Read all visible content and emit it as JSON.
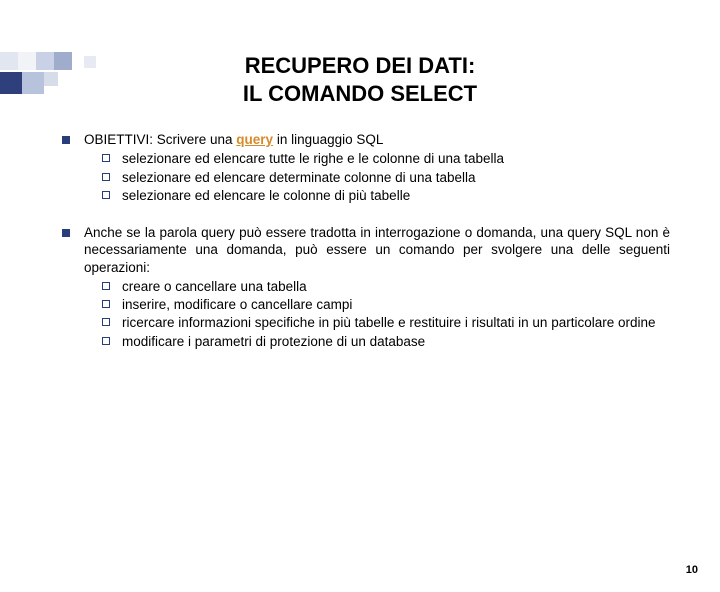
{
  "title": {
    "line1": "RECUPERO DEI DATI:",
    "line2": "IL COMANDO SELECT"
  },
  "block1": {
    "lead_pre": "OBIETTIVI: Scrivere una ",
    "lead_query": "query",
    "lead_post": " in linguaggio SQL",
    "items": [
      "selezionare ed elencare tutte le righe e le colonne di una tabella",
      "selezionare ed elencare determinate colonne di una tabella",
      "selezionare ed elencare le colonne di più tabelle"
    ]
  },
  "block2": {
    "lead": "Anche se la parola query può essere tradotta in interrogazione o domanda, una query SQL non è necessariamente una domanda, può essere un comando per svolgere una delle seguenti operazioni:",
    "items": [
      "creare o cancellare una tabella",
      "inserire, modificare o cancellare campi",
      "ricercare informazioni specifiche in più tabelle e restituire i risultati in un particolare ordine",
      "modificare i parametri di protezione di un database"
    ]
  },
  "page_number": "10"
}
